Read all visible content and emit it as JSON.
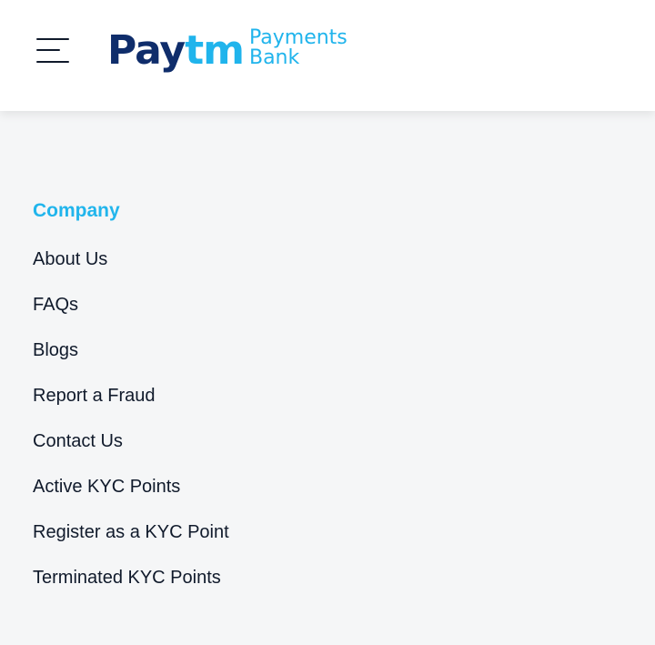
{
  "header": {
    "logo": {
      "pay": "Pay",
      "tm": "tm",
      "line1": "Payments",
      "line2": "Bank"
    },
    "menu_icon": "hamburger-menu-icon"
  },
  "company": {
    "heading": "Company",
    "links": [
      "About Us",
      "FAQs",
      "Blogs",
      "Report a Fraud",
      "Contact Us",
      "Active KYC Points",
      "Register as a KYC Point",
      "Terminated KYC Points"
    ]
  },
  "colors": {
    "brand_navy": "#0f2d6b",
    "brand_blue": "#20b4ec",
    "text": "#101a2b",
    "background": "#f5f6f7"
  }
}
